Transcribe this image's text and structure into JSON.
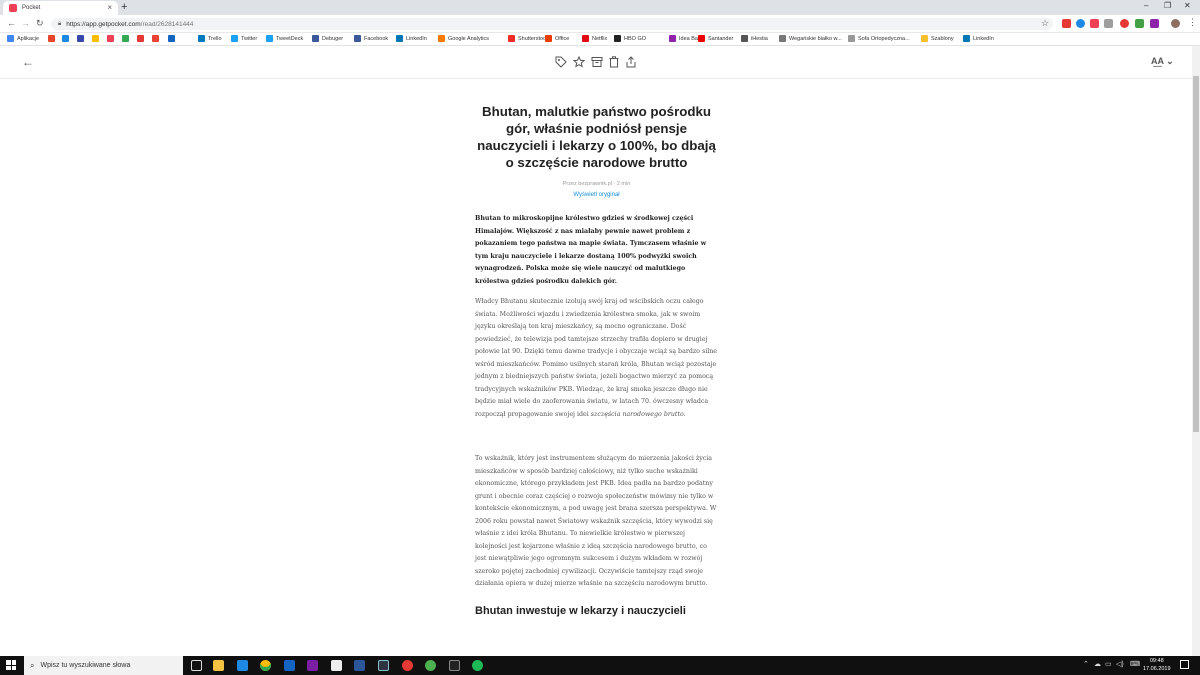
{
  "browser": {
    "tab_title": "Pocket",
    "tab_close": "×",
    "new_tab": "+",
    "url_host": "https://app.getpocket.com",
    "url_path": "/read/2628141444",
    "win_min": "–",
    "win_max": "❐",
    "win_close": "✕"
  },
  "bookmarks": [
    {
      "label": "Aplikacje",
      "color": "#4285f4"
    },
    {
      "label": "",
      "color": "#e8452c"
    },
    {
      "label": "",
      "color": "#1e88e5"
    },
    {
      "label": "",
      "color": "#3949ab"
    },
    {
      "label": "",
      "color": "#fbbc05"
    },
    {
      "label": "",
      "color": "#ef4056"
    },
    {
      "label": "",
      "color": "#34a853"
    },
    {
      "label": "",
      "color": "#e53935"
    },
    {
      "label": "",
      "color": "#ea4335"
    },
    {
      "label": "",
      "color": "#1565c0"
    },
    {
      "label": "Trello",
      "color": "#0079bf"
    },
    {
      "label": "Twitter",
      "color": "#1da1f2"
    },
    {
      "label": "TweetDeck",
      "color": "#1da1f2"
    },
    {
      "label": "Debuger",
      "color": "#3b5998"
    },
    {
      "label": "Facebook",
      "color": "#3b5998"
    },
    {
      "label": "LinkedIn",
      "color": "#0077b5"
    },
    {
      "label": "Google Analytics",
      "color": "#f57c00"
    },
    {
      "label": "Shutterstock",
      "color": "#ee2b24"
    },
    {
      "label": "Office",
      "color": "#eb3c00"
    },
    {
      "label": "Netflix",
      "color": "#e50914"
    },
    {
      "label": "HBO GO",
      "color": "#222222"
    },
    {
      "label": "Idea Bank",
      "color": "#8e24aa"
    },
    {
      "label": "Santander",
      "color": "#ec0000"
    },
    {
      "label": "iHestia",
      "color": "#555555"
    },
    {
      "label": "Wegańskie białko w...",
      "color": "#777777"
    },
    {
      "label": "Sofa Ortopedyczna...",
      "color": "#999999"
    },
    {
      "label": "Szablony",
      "color": "#fbc02d"
    },
    {
      "label": "LinkedIn",
      "color": "#0077b5"
    }
  ],
  "pocket": {
    "back_icon": "←",
    "aa_label": "A͟A ⌄"
  },
  "article": {
    "title": "Bhutan, malutkie państwo pośrodku gór, właśnie podniósł pensje nauczycieli i lekarzy o 100%, bo dbają o szczęście narodowe brutto",
    "meta": "Przez  bezprawnik.pl · 2 min",
    "view_original": "Wyświetl oryginał",
    "lead": "Bhutan to mikroskopijne królestwo gdzieś w środkowej części Himalajów. Większość z nas miałaby pewnie nawet problem z pokazaniem tego państwa na mapie świata. Tymczasem właśnie w tym kraju nauczyciele i lekarze dostaną 100% podwyżki swoich wynagrodzeń. Polska może się wiele nauczyć od malutkiego królestwa gdzieś pośrodku dalekich gór.",
    "p1": "Władcy Bhutanu skutecznie izolują swój kraj od wścibskich oczu całego świata. Możliwości wjazdu i zwiedzenia królestwa smoka, jak w swoim języku określają ten kraj mieszkańcy, są mocno ograniczane. Dość powiedzieć, że telewizja pod tamtejsze strzechy trafiła dopiero w drugiej połowie lat 90. Dzięki temu dawne tradycje i obyczaje wciąż są bardzo silne wśród mieszkańców. Pomimo usilnych starań króla, Bhutan wciąż pozostaje jednym z biedniejszych państw świata, jeżeli bogactwo mierzyć za pomocą tradycyjnych wskaźników PKB. Wiedząc, że kraj smoka jeszcze długo nie będzie miał wiele do zaoferowania światu, w latach 70. ówczesny władca rozpoczął propagowanie swojej idei ",
    "p1_em": "szczęścia narodowego brutto",
    "p1_end": ".",
    "p2": "To wskaźnik, który jest instrumentem służącym do mierzenia jakości życia mieszkańców w sposób bardziej całościowy, niż tylko suche wskaźniki ekonomiczne, którego przykładem jest PKB. Idea padła na bardzo podatny grunt i obecnie coraz częściej o rozwoju społeczeństw mówimy nie tylko w kontekście ekonomicznym, a pod uwagę jest brana szersza perspektywa. W 2006 roku powstał nawet Światowy wskaźnik szczęścia, który wywodzi się właśnie z idei króla Bhutanu. To niewielkie królestwo w pierwszej kolejności jest kojarzone właśnie z ideą szczęścia narodowego brutto, co jest niewątpliwie jego ogromnym sukcesem i dużym wkładem w rozwój szeroko pojętej zachodniej cywilizacji. Oczywiście tamtejszy rząd swoje działania opiera w dużej mierze właśnie na szczęściu narodowym brutto.",
    "subhead": "Bhutan inwestuje w lekarzy i nauczycieli"
  },
  "taskbar": {
    "search_placeholder": "Wpisz tu wyszukiwane słowa",
    "time": "09:48",
    "date": "17.06.2019"
  }
}
